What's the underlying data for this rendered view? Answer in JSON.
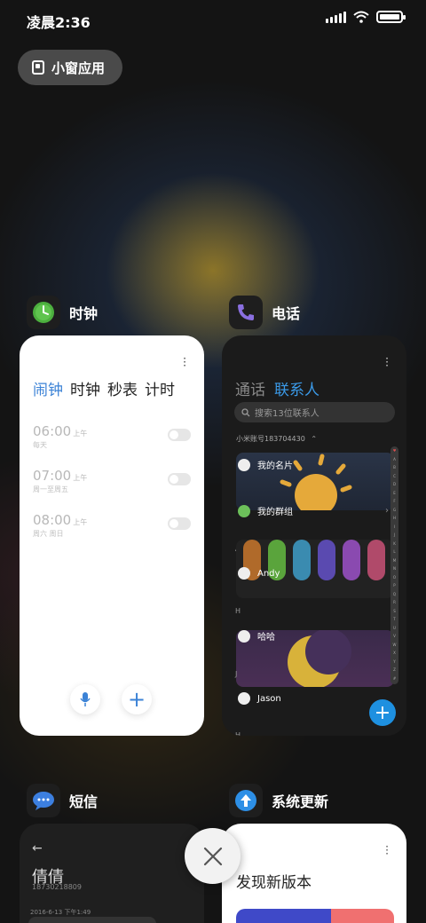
{
  "status_bar": {
    "time": "凌晨2:36"
  },
  "floating_button": {
    "label": "小窗应用"
  },
  "clock_app": {
    "name": "时钟",
    "tabs": [
      "闹钟",
      "时钟",
      "秒表",
      "计时"
    ],
    "alarms": [
      {
        "time": "06:00",
        "ampm": "上午",
        "repeat": "每天"
      },
      {
        "time": "07:00",
        "ampm": "上午",
        "repeat": "周一至周五"
      },
      {
        "time": "08:00",
        "ampm": "上午",
        "repeat": "周六 周日"
      }
    ]
  },
  "phone_app": {
    "name": "电话",
    "tabs": [
      "通话",
      "联系人"
    ],
    "search_placeholder": "搜索13位联系人",
    "account": "小米账号183704430",
    "contacts": {
      "my_card": "我的名片",
      "my_group": "我的群组",
      "andy": "Andy",
      "haha": "哈哈",
      "jason": "Jason"
    },
    "letters": [
      "A",
      "H",
      "J",
      "H"
    ],
    "index_letters": [
      "♥",
      "A",
      "B",
      "C",
      "D",
      "E",
      "F",
      "G",
      "H",
      "I",
      "J",
      "K",
      "L",
      "M",
      "N",
      "O",
      "P",
      "Q",
      "R",
      "S",
      "T",
      "U",
      "V",
      "W",
      "X",
      "Y",
      "Z",
      "#"
    ]
  },
  "sms_app": {
    "name": "短信",
    "contact_name": "倩倩",
    "contact_number": "18730218809",
    "date": "2016-6-13 下午1:49"
  },
  "update_app": {
    "name": "系统更新",
    "headline": "发现新版本"
  },
  "colors": {
    "accent_blue": "#3b82d6",
    "phone_accent": "#3b9ae8",
    "clock_icon_green": "#4caf3e"
  }
}
